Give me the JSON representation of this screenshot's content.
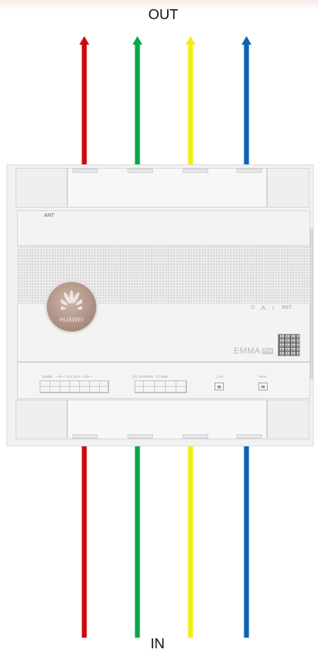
{
  "labels": {
    "top": "OUT",
    "bottom": "IN"
  },
  "wire_colors": [
    "#cc0a0a",
    "#0aa64a",
    "#f2ee12",
    "#0b64b4"
  ],
  "device": {
    "antenna_label": "ANT",
    "brand": "HUAWEI",
    "model": "EMMA",
    "model_badge": "Pro",
    "indicator_labels": [
      "⏻",
      "⁂",
      "⌇",
      "RST"
    ],
    "terminal_labels": {
      "left_group": "RS485    —DI— 12V_OUT —DO—",
      "middle_group": "12V_IN RS485   CT input",
      "lan": "LAN",
      "wan": "WAN"
    }
  }
}
